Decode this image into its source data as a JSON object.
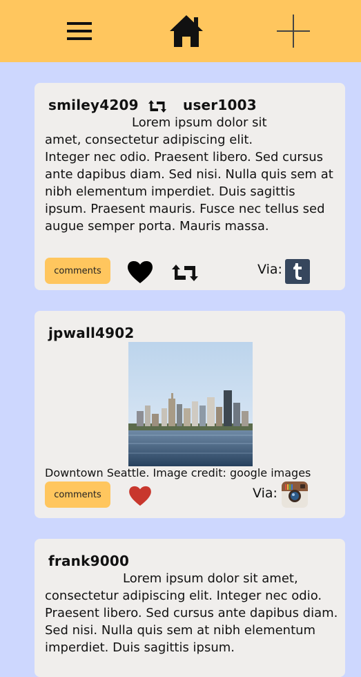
{
  "nav": {
    "menu_icon": "hamburger-menu-icon",
    "home_icon": "home-icon",
    "add_icon": "plus-icon"
  },
  "posts": [
    {
      "username": "smiley4209",
      "reblog_icon": "reblog-icon",
      "reblogged_from": "user1003",
      "text_lead": "Lorem ipsum dolor sit",
      "text_rest": "amet, consectetur adipiscing elit.\nInteger nec odio. Praesent libero. Sed cursus ante dapibus diam. Sed nisi. Nulla quis sem at nibh elementum imperdiet. Duis sagittis ipsum. Praesent mauris. Fusce nec tellus sed augue semper porta. Mauris massa.",
      "comments_label": "comments",
      "like_icon": "heart-icon",
      "like_color": "#000000",
      "via_label": "Via:",
      "source_icon": "tumblr-icon"
    },
    {
      "username": "jpwall4902",
      "image_icon": "seattle-skyline-photo",
      "caption": "Downtown Seattle. Image credit: google images",
      "comments_label": "comments",
      "like_icon": "heart-icon",
      "like_color": "#c8372d",
      "via_label": "Via:",
      "source_icon": "instagram-icon"
    },
    {
      "username": "frank9000",
      "text_lead": "Lorem ipsum dolor sit amet,",
      "text_rest": "consectetur adipiscing elit. Integer nec odio. Praesent libero. Sed cursus ante dapibus diam. Sed nisi. Nulla quis sem at nibh elementum imperdiet. Duis sagittis ipsum."
    }
  ],
  "colors": {
    "background": "#cdd7fe",
    "topbar": "#ffc65e",
    "card": "#f0eeec",
    "accent_button": "#ffc65e",
    "tumblr": "#36465d"
  }
}
